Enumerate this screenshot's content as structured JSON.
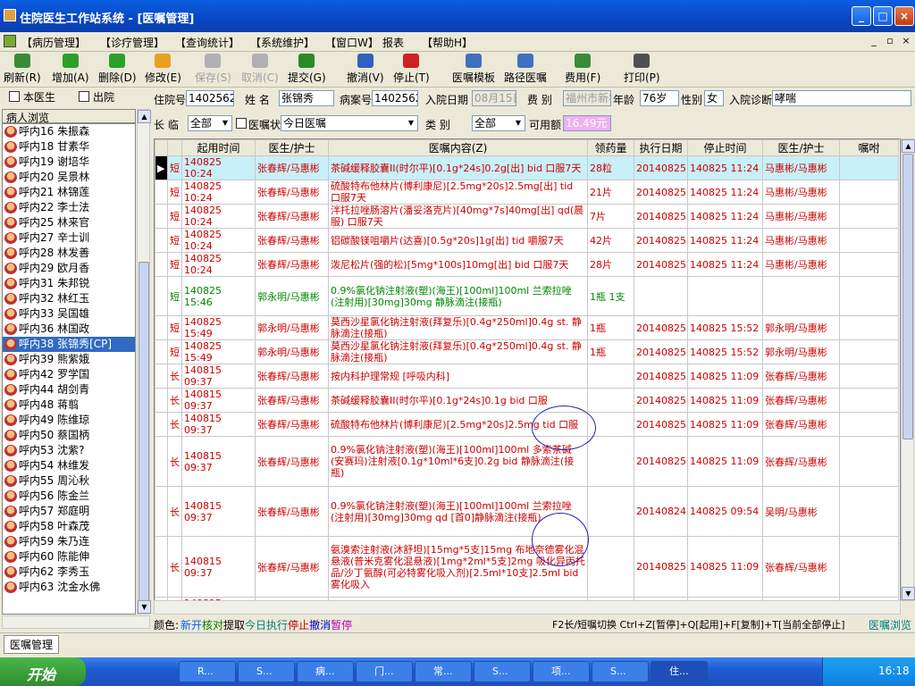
{
  "window": {
    "title": "住院医生工作站系统 - [医嘱管理]",
    "btn_min": "_",
    "btn_max": "□",
    "btn_close": "×"
  },
  "menu": [
    "【病历管理】",
    "【诊疗管理】",
    "【查询统计】",
    "【系统维护】",
    "【窗口W】",
    "报表",
    "【帮助H】"
  ],
  "toolbar": [
    {
      "label": "刷新(R)",
      "icon": "refresh-icon",
      "color": "#3a8a3a",
      "enabled": true
    },
    {
      "label": "增加(A)",
      "icon": "add-icon",
      "color": "#2aa02a",
      "enabled": true
    },
    {
      "label": "删除(D)",
      "icon": "delete-icon",
      "color": "#2aa02a",
      "enabled": true
    },
    {
      "label": "修改(E)",
      "icon": "edit-icon",
      "color": "#e8a020",
      "enabled": true
    },
    {
      "label": "保存(S)",
      "icon": "save-icon",
      "color": "#b0b0b0",
      "enabled": false
    },
    {
      "label": "取消(C)",
      "icon": "cancel-icon",
      "color": "#b0b0b0",
      "enabled": false
    },
    {
      "label": "提交(G)",
      "icon": "submit-icon",
      "color": "#2a8a2a",
      "enabled": true
    },
    {
      "label": "撤消(V)",
      "icon": "undo-icon",
      "color": "#3060c0",
      "enabled": true
    },
    {
      "label": "停止(T)",
      "icon": "stop-icon",
      "color": "#d02020",
      "enabled": true
    },
    {
      "label": "医嘱模板",
      "icon": "template-icon",
      "color": "#4070c0",
      "enabled": true
    },
    {
      "label": "路径医嘱",
      "icon": "path-icon",
      "color": "#4070c0",
      "enabled": true
    },
    {
      "label": "费用(F)",
      "icon": "fee-icon",
      "color": "#3a8a3a",
      "enabled": true
    },
    {
      "label": "打印(P)",
      "icon": "print-icon",
      "color": "#505050",
      "enabled": true
    }
  ],
  "sidebar": {
    "filter_doctor": "本医生",
    "filter_discharge": "出院",
    "title": "病人浏览",
    "patients": [
      "呼内16 朱振森",
      "呼内18 甘素华",
      "呼内19 谢培华",
      "呼内20 吴景林",
      "呼内21 林锦莲",
      "呼内22 李士法",
      "呼内25 林来官",
      "呼内27 辛士训",
      "呼内28 林发善",
      "呼内29 欧月香",
      "呼内31 朱邦锐",
      "呼内32 林红玉",
      "呼内33 吴国雄",
      "呼内36 林国政",
      "呼内38 张锦秀[CP]",
      "呼内39 熊紫娥",
      "呼内42 罗学国",
      "呼内44 胡剑青",
      "呼内48 蒋翦",
      "呼内49 陈维琼",
      "呼内50 蔡国柄",
      "呼内53 沈紫?",
      "呼内54 林维发",
      "呼内55 周沁秋",
      "呼内56 陈金兰",
      "呼内57 郑庭明",
      "呼内58 叶森茂",
      "呼内59 朱乃连",
      "呼内60 陈能伸",
      "呼内62 李秀玉",
      "呼内63 沈金水佛"
    ],
    "selected_index": 14
  },
  "info": {
    "admission_no_label": "住院号",
    "admission_no": "1402562",
    "name_label": "姓  名",
    "name": "张锦秀",
    "record_no_label": "病案号",
    "record_no": "1402562",
    "admit_date_label": "入院日期",
    "admit_date": "08月15日",
    "fee_type_label": "费  别",
    "fee_type": "福州市新农",
    "age_label": "年龄",
    "age": "76岁",
    "sex_label": "性别",
    "sex": "女",
    "diagnosis_label": "入院诊断",
    "diagnosis": "哮喘",
    "term_label": "长  临",
    "term": "全部",
    "status_label": "医嘱状态",
    "status": "今日医嘱",
    "type_label": "类  别",
    "type": "全部",
    "balance_label": "可用额",
    "balance": "16.49元"
  },
  "table": {
    "headers": [
      "",
      "起用时间",
      "医生/护士",
      "医嘱内容(Z)",
      "领药量",
      "执行日期",
      "停止时间",
      "医生/护士",
      "嘱咐"
    ],
    "rows": [
      {
        "term": "短",
        "start": "140825 10:24",
        "doc": "张春辉/马惠彬",
        "content": "茶碱缓释胶囊II(时尔平)[0.1g*24s]0.2g[出] bid 口服7天",
        "qty": "28粒",
        "exec": "20140825",
        "stop": "140825 11:24",
        "doc2": "马惠彬/马惠彬",
        "note": "",
        "color": "red",
        "selected": true
      },
      {
        "term": "短",
        "start": "140825 10:24",
        "doc": "张春辉/马惠彬",
        "content": "硫酸特布他林片(博利康尼)[2.5mg*20s]2.5mg[出] tid 口服7天",
        "qty": "21片",
        "exec": "20140825",
        "stop": "140825 11:24",
        "doc2": "马惠彬/马惠彬",
        "note": "",
        "color": "red"
      },
      {
        "term": "短",
        "start": "140825 10:24",
        "doc": "张春辉/马惠彬",
        "content": "泮托拉唑肠溶片(潘妥洛克片)[40mg*7s]40mg[出] qd(晨服) 口服7天",
        "qty": "7片",
        "exec": "20140825",
        "stop": "140825 11:24",
        "doc2": "马惠彬/马惠彬",
        "note": "",
        "color": "red"
      },
      {
        "term": "短",
        "start": "140825 10:24",
        "doc": "张春辉/马惠彬",
        "content": "铝碳酸镁咀嚼片(达喜)[0.5g*20s]1g[出] tid 嚼服7天",
        "qty": "42片",
        "exec": "20140825",
        "stop": "140825 11:24",
        "doc2": "马惠彬/马惠彬",
        "note": "",
        "color": "red"
      },
      {
        "term": "短",
        "start": "140825 10:24",
        "doc": "张春辉/马惠彬",
        "content": "泼尼松片(强的松)[5mg*100s]10mg[出] bid 口服7天",
        "qty": "28片",
        "exec": "20140825",
        "stop": "140825 11:24",
        "doc2": "马惠彬/马惠彬",
        "note": "",
        "color": "red"
      },
      {
        "term": "短",
        "start": "140825 15:46",
        "doc": "郭永明/马惠彬",
        "content": "0.9%氯化钠注射液(塑)(海王)[100ml]100ml 兰索拉唑(注射用)[30mg]30mg  静脉滴注(接瓶)",
        "qty": "1瓶 1支",
        "exec": "",
        "stop": "",
        "doc2": "",
        "note": "",
        "color": "grn"
      },
      {
        "term": "短",
        "start": "140825 15:49",
        "doc": "郭永明/马惠彬",
        "content": "莫西沙星氯化钠注射液(拜复乐)[0.4g*250ml]0.4g st. 静脉滴注(接瓶)",
        "qty": "1瓶",
        "exec": "20140825",
        "stop": "140825 15:52",
        "doc2": "郭永明/马惠彬",
        "note": "",
        "color": "red"
      },
      {
        "term": "短",
        "start": "140825 15:49",
        "doc": "郭永明/马惠彬",
        "content": "莫西沙星氯化钠注射液(拜复乐)[0.4g*250ml]0.4g st. 静脉滴注(接瓶)",
        "qty": "1瓶",
        "exec": "20140825",
        "stop": "140825 15:52",
        "doc2": "郭永明/马惠彬",
        "note": "",
        "color": "red"
      },
      {
        "term": "长",
        "start": "140815 09:37",
        "doc": "张春辉/马惠彬",
        "content": "按内科护理常规   [呼吸内科]",
        "qty": "",
        "exec": "20140825",
        "stop": "140825 11:09",
        "doc2": "张春辉/马惠彬",
        "note": "",
        "color": "red"
      },
      {
        "term": "长",
        "start": "140815 09:37",
        "doc": "张春辉/马惠彬",
        "content": "茶碱缓释胶囊II(时尔平)[0.1g*24s]0.1g bid 口服",
        "qty": "",
        "exec": "20140825",
        "stop": "140825 11:09",
        "doc2": "张春辉/马惠彬",
        "note": "",
        "color": "red"
      },
      {
        "term": "长",
        "start": "140815 09:37",
        "doc": "张春辉/马惠彬",
        "content": "硫酸特布他林片(博利康尼)[2.5mg*20s]2.5mg tid 口服",
        "qty": "",
        "exec": "20140825",
        "stop": "140825 11:09",
        "doc2": "张春辉/马惠彬",
        "note": "",
        "color": "red"
      },
      {
        "term": "长",
        "start": "140815 09:37",
        "doc": "张春辉/马惠彬",
        "content": "0.9%氯化钠注射液(塑)(海王)[100ml]100ml 多索茶碱(安赛玛)注射液[0.1g*10ml*6支]0.2g  bid 静脉滴注(接瓶)",
        "qty": "",
        "exec": "20140825",
        "stop": "140825 11:09",
        "doc2": "张春辉/马惠彬",
        "note": "",
        "color": "red"
      },
      {
        "term": "长",
        "start": "140815 09:37",
        "doc": "张春辉/马惠彬",
        "content": "0.9%氯化钠注射液(塑)(海王)[100ml]100ml 兰索拉唑(注射用)[30mg]30mg  qd [首0]静脉滴注(接瓶)",
        "qty": "",
        "exec": "20140824",
        "stop": "140825 09:54",
        "doc2": "吴明/马惠彬",
        "note": "",
        "color": "red"
      },
      {
        "term": "长",
        "start": "140815 09:37",
        "doc": "张春辉/马惠彬",
        "content": "氨溴索注射液(沐舒坦)[15mg*5支]15mg 布地奈德雾化混悬液(普米克雾化混悬液)[1mg*2ml*5支]2mg 吸化异丙托品/沙丁氨醇(可必特雾化吸入剂)[2.5ml*10支]2.5ml  bid 雾化吸入",
        "qty": "",
        "exec": "20140825",
        "stop": "140825 11:09",
        "doc2": "张春辉/马惠彬",
        "note": "",
        "color": "red"
      },
      {
        "term": "长",
        "start": "140815 09:37",
        "doc": "张春辉/马惠彬",
        "content": "普通饮食   [呼吸内科]",
        "qty": "",
        "exec": "20140825",
        "stop": "140825 11:09",
        "doc2": "张春辉/马惠彬",
        "note": "",
        "color": "red"
      }
    ]
  },
  "status": {
    "legend_prefix": "颜色:",
    "legend": [
      {
        "text": "新开",
        "color": "#0060ff"
      },
      {
        "text": "核对",
        "color": "#008000"
      },
      {
        "text": "提取",
        "color": "#000000"
      },
      {
        "text": "今日执行",
        "color": "#008080"
      },
      {
        "text": "停止",
        "color": "#c00000"
      },
      {
        "text": "撤消",
        "color": "#0000c0"
      },
      {
        "text": "暂停",
        "color": "#c000c0"
      }
    ],
    "hotkeys": "F2长/短嘱切换 Ctrl+Z[暂停]+Q[起用]+F[复制]+T[当前全部停止]",
    "right_text": "医嘱浏览"
  },
  "mdi": {
    "tab": "医嘱管理"
  },
  "taskbar": {
    "start": "开始",
    "buttons": [
      "R...",
      "S...",
      "病...",
      "门...",
      "常...",
      "S...",
      "项...",
      "S...",
      "住..."
    ],
    "time": "16:18"
  }
}
